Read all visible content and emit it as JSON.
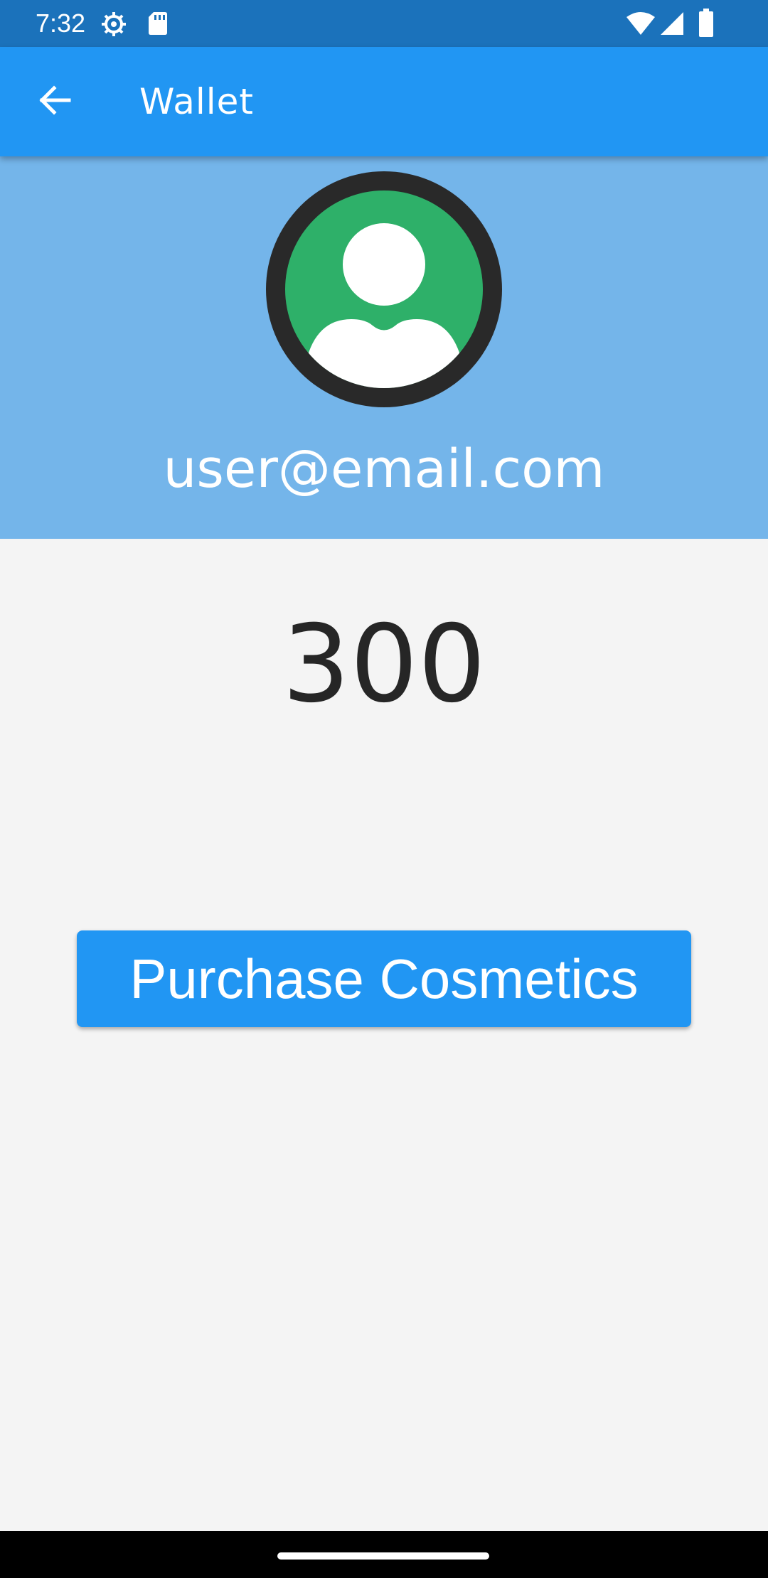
{
  "status_bar": {
    "time": "7:32",
    "left_icons": [
      "gear-icon",
      "sd-card-icon"
    ],
    "right_icons": [
      "wifi-icon",
      "signal-icon",
      "battery-icon"
    ]
  },
  "app_bar": {
    "title": "Wallet",
    "back_icon": "arrow-back-icon"
  },
  "profile": {
    "avatar_icon": "user-avatar-icon",
    "email": "user@email.com"
  },
  "wallet": {
    "balance": "300",
    "purchase_label": "Purchase Cosmetics"
  },
  "colors": {
    "status_bar": "#1b72bb",
    "app_bar": "#2196f3",
    "profile_header": "#74b5ea",
    "avatar_ring": "#292929",
    "avatar_fill": "#2eb069",
    "button": "#2196f3",
    "background": "#f4f4f4"
  }
}
